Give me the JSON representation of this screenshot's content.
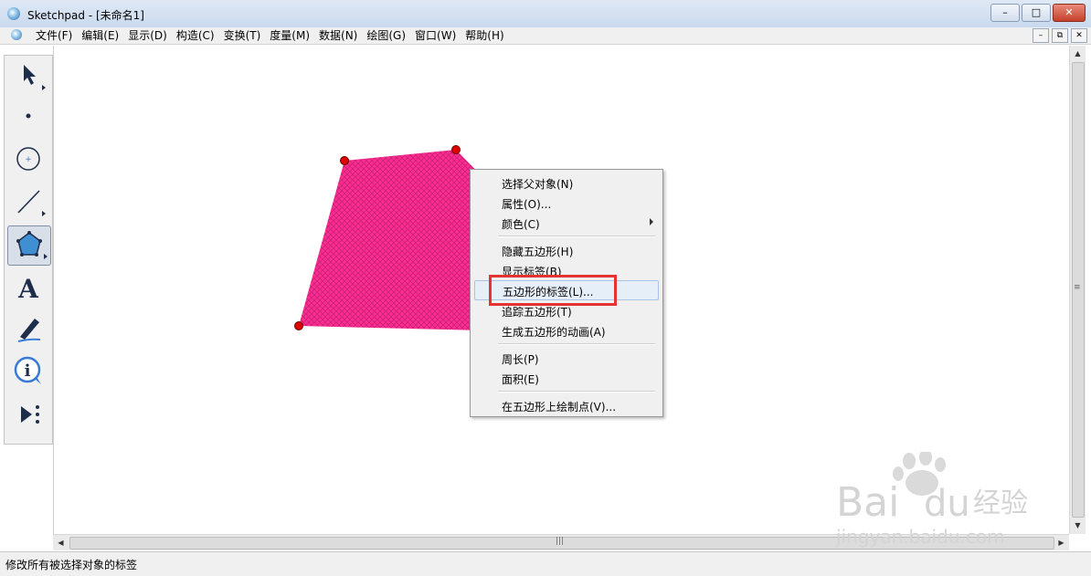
{
  "window": {
    "title": "Sketchpad  - [未命名1]",
    "buttons": {
      "minimize": "–",
      "maximize": "□",
      "close": "✕"
    }
  },
  "menubar": {
    "items": [
      "文件(F)",
      "编辑(E)",
      "显示(D)",
      "构造(C)",
      "变换(T)",
      "度量(M)",
      "数据(N)",
      "绘图(G)",
      "窗口(W)",
      "帮助(H)"
    ],
    "mdi_buttons": {
      "minimize": "–",
      "restore": "⧉",
      "close": "✕"
    }
  },
  "toolbox": {
    "tools": [
      {
        "name": "arrow-tool-icon",
        "active": false
      },
      {
        "name": "point-tool-icon",
        "active": false
      },
      {
        "name": "compass-tool-icon",
        "active": false
      },
      {
        "name": "line-tool-icon",
        "active": false
      },
      {
        "name": "polygon-tool-icon",
        "active": true
      },
      {
        "name": "text-tool-icon",
        "active": false,
        "glyph": "A"
      },
      {
        "name": "marker-tool-icon",
        "active": false
      },
      {
        "name": "information-tool-icon",
        "active": false,
        "glyph": "i"
      },
      {
        "name": "custom-tool-icon",
        "active": false
      }
    ]
  },
  "canvas": {
    "polygon": {
      "fill_color": "#ff2d8f",
      "hatch_color": "#c8207a",
      "point_color": "#e00000"
    }
  },
  "context_menu": {
    "items": [
      {
        "label": "选择父对象(N)",
        "submenu": false
      },
      {
        "label": "属性(O)...",
        "submenu": false
      },
      {
        "label": "颜色(C)",
        "submenu": true
      },
      {
        "label": "隐藏五边形(H)",
        "submenu": false
      },
      {
        "label": "显示标签(B)",
        "submenu": false
      },
      {
        "label": "五边形的标签(L)...",
        "submenu": false,
        "highlighted": true
      },
      {
        "label": "追踪五边形(T)",
        "submenu": false
      },
      {
        "label": "生成五边形的动画(A)",
        "submenu": false
      },
      {
        "label": "周长(P)",
        "submenu": false
      },
      {
        "label": "面积(E)",
        "submenu": false
      },
      {
        "label": "在五边形上绘制点(V)...",
        "submenu": false
      }
    ],
    "highlight_color": "#e53333"
  },
  "status": {
    "text": "修改所有被选择对象的标签"
  },
  "watermark": {
    "brand": "Bai",
    "brand2": "du",
    "chinese": "经验",
    "url": "jingyan.baidu.com"
  }
}
